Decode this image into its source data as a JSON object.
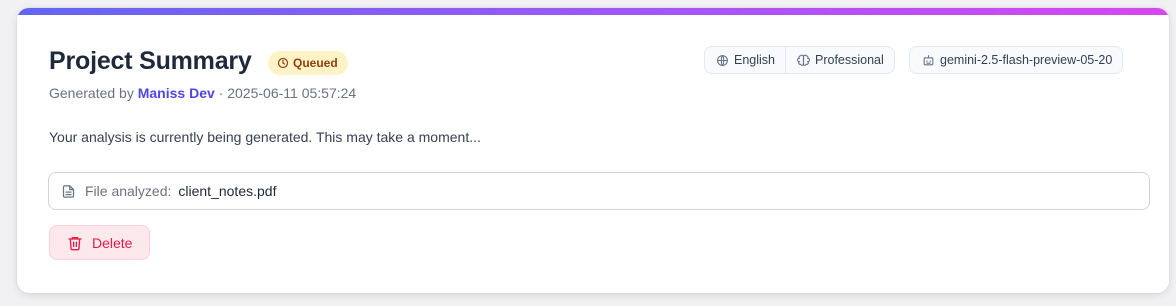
{
  "card": {
    "title": "Project Summary",
    "status_badge": "Queued",
    "generated_by_prefix": "Generated by",
    "author": "Maniss Dev",
    "separator": "·",
    "timestamp": "2025-06-11 05:57:24",
    "language": "English",
    "tone": "Professional",
    "model": "gemini-2.5-flash-preview-05-20",
    "status_message": "Your analysis is currently being generated. This may take a moment...",
    "file_label": "File analyzed:",
    "file_name": "client_notes.pdf",
    "delete_label": "Delete"
  },
  "icons": {
    "badge": "clock-icon",
    "language": "globe-icon",
    "tone": "brain-icon",
    "model": "bot-icon",
    "file": "file-text-icon",
    "delete": "trash-icon"
  },
  "colors": {
    "gradient_start": "#6366f1",
    "gradient_end": "#d946ef",
    "badge_bg": "#fef3c7",
    "badge_text": "#92400e",
    "author": "#4f46e5",
    "delete_text": "#e11d48",
    "delete_bg": "#fde8ec"
  }
}
